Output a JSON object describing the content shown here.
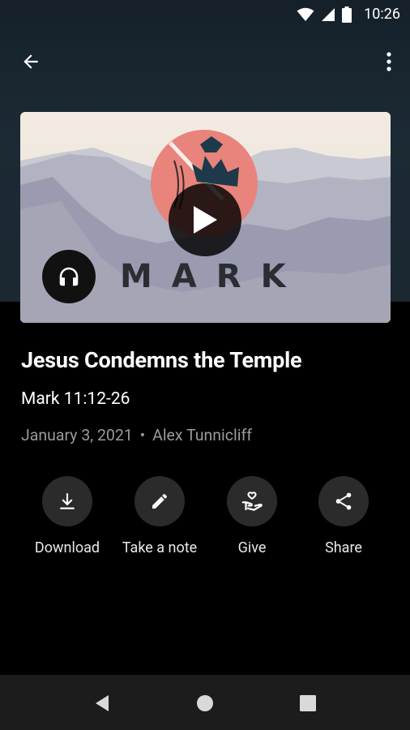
{
  "status_bar": {
    "time": "10:26"
  },
  "app_bar": {
    "back_icon": "arrow-back-icon",
    "more_icon": "more-vert-icon"
  },
  "artwork": {
    "series_text": "MARK",
    "play_icon": "play-icon",
    "audio_icon": "headphones-icon"
  },
  "message": {
    "title": "Jesus Condemns the Temple",
    "scripture": "Mark 11:12-26",
    "date": "January 3, 2021",
    "separator": "•",
    "speaker": "Alex Tunnicliff"
  },
  "actions": [
    {
      "label": "Download",
      "icon": "download-icon"
    },
    {
      "label": "Take a note",
      "icon": "pencil-icon"
    },
    {
      "label": "Give",
      "icon": "give-hand-heart-icon"
    },
    {
      "label": "Share",
      "icon": "share-icon"
    }
  ],
  "nav_bar": {
    "back": "nav-back-icon",
    "home": "nav-home-icon",
    "recents": "nav-recents-icon"
  },
  "colors": {
    "accent_circle": "#e57f78",
    "crown": "#1e3a4a",
    "background": "#000000",
    "header": "#1b2731"
  }
}
